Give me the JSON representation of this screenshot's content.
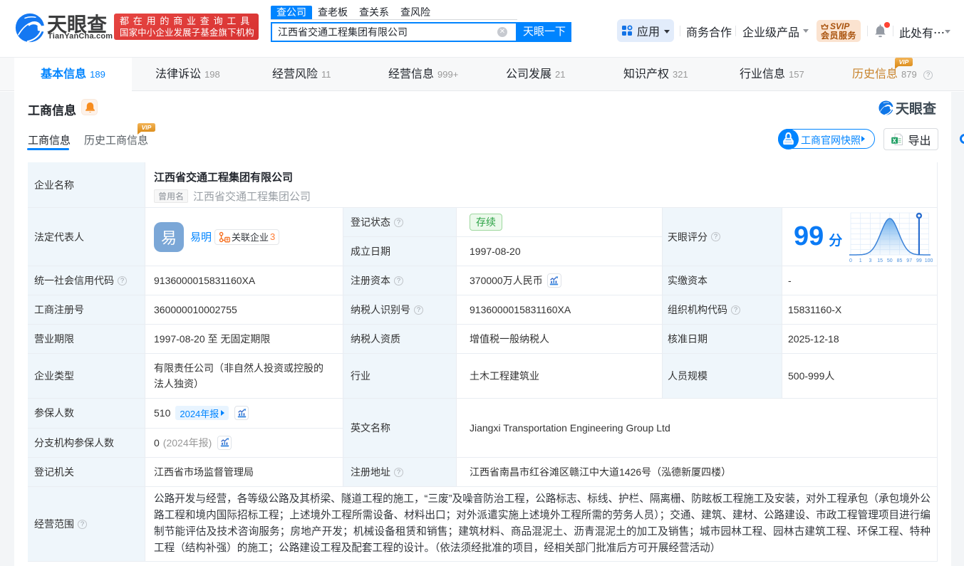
{
  "icons": {
    "help": "?",
    "clear": "✕",
    "ellipsis_caret": "",
    "score_ticks": [
      "0",
      "1",
      "3",
      "15",
      "50",
      "85",
      "97",
      "99",
      "100"
    ]
  },
  "brand": {
    "logo_title": "天眼查",
    "logo_domain": "TianYanCha.com",
    "slogan_line1": "都在用的商业查询工具",
    "slogan_line2": "国家中小企业发展子基金旗下机构",
    "watermark_title": "天眼查"
  },
  "header": {
    "search_tabs": [
      {
        "label": "查公司",
        "active": true
      },
      {
        "label": "查老板",
        "active": false
      },
      {
        "label": "查关系",
        "active": false
      },
      {
        "label": "查风险",
        "active": false
      }
    ],
    "search_value": "江西省交通工程集团有限公司",
    "search_button": "天眼一下",
    "menu_apps": "应用",
    "menu_biz": "商务合作",
    "menu_enterprise": "企业级产品",
    "svip_line1": "SVIP",
    "svip_line2": "会员服务",
    "user_entry": "此处有⋯"
  },
  "nav_tabs": [
    {
      "label": "基本信息",
      "count": "189"
    },
    {
      "label": "法律诉讼",
      "count": "198"
    },
    {
      "label": "经营风险",
      "count": "11"
    },
    {
      "label": "经营信息",
      "count": "999+"
    },
    {
      "label": "公司发展",
      "count": "21"
    },
    {
      "label": "知识产权",
      "count": "321"
    },
    {
      "label": "行业信息",
      "count": "157"
    },
    {
      "label": "历史信息",
      "count": "879",
      "vip": "VIP"
    }
  ],
  "section": {
    "title": "工商信息",
    "tab_current": "工商信息",
    "tab_history": "历史工商信息",
    "tab_history_vip": "VIP",
    "snapshot_button": "工商官网快照",
    "export_button": "导出"
  },
  "company": {
    "name_label": "企业名称",
    "name": "江西省交通工程集团有限公司",
    "former_tag": "曾用名",
    "former_name": "江西省交通工程集团公司",
    "legal_label": "法定代表人",
    "legal_avatar": "易",
    "legal_name": "易明",
    "related_label": "关联企业",
    "related_count": "3",
    "reg_status_label": "登记状态",
    "reg_status": "存续",
    "establish_label": "成立日期",
    "establish_date": "1997-08-20",
    "score_label": "天眼评分",
    "score": "99",
    "score_unit": "分",
    "uscc_label": "统一社会信用代码",
    "uscc": "9136000015831160XA",
    "reg_capital_label": "注册资本",
    "reg_capital": "370000万人民币",
    "paid_capital_label": "实缴资本",
    "paid_capital": "-",
    "reg_no_label": "工商注册号",
    "reg_no": "360000010002755",
    "tax_id_label": "纳税人识别号",
    "tax_id": "9136000015831160XA",
    "org_code_label": "组织机构代码",
    "org_code": "15831160-X",
    "term_label": "营业期限",
    "term": "1997-08-20 至 无固定期限",
    "tax_quality_label": "纳税人资质",
    "tax_quality": "增值税一般纳税人",
    "approve_date_label": "核准日期",
    "approve_date": "2025-12-18",
    "type_label": "企业类型",
    "type": "有限责任公司（非自然人投资或控股的法人独资）",
    "industry_label": "行业",
    "industry": "土木工程建筑业",
    "staff_label": "人员规模",
    "staff": "500-999人",
    "insured_label": "参保人数",
    "insured": "510",
    "insured_report": "2024年报",
    "branch_insured_label": "分支机构参保人数",
    "branch_insured": "0",
    "branch_insured_report": "(2024年报)",
    "en_name_label": "英文名称",
    "en_name": "Jiangxi Transportation Engineering Group Ltd",
    "authority_label": "登记机关",
    "authority": "江西省市场监督管理局",
    "address_label": "注册地址",
    "address": "江西省南昌市红谷滩区赣江中大道1426号（泓德新厦四楼）",
    "scope_label": "经营范围",
    "scope": "公路开发与经营，各等级公路及其桥梁、隧道工程的施工，“三废”及噪音防治工程，公路标志、标线、护栏、隔离栅、防眩板工程施工及安装，对外工程承包（承包境外公路工程和境内国际招标工程；上述境外工程所需设备、材料出口；对外派遣实施上述境外工程所需的劳务人员）；交通、建筑、建材、公路建设、市政工程管理项目进行编制节能评估及技术咨询服务；房地产开发；机械设备租赁和销售；建筑材料、商品混泥土、沥青混泥土的加工及销售；城市园林工程、园林古建筑工程、环保工程、特种工程（结构补强）的施工；公路建设工程及配套工程的设计。（依法须经批准的项目，经相关部门批准后方可开展经营活动）"
  },
  "score_chart": {
    "type": "area",
    "title": "天眼评分分布曲线",
    "x_ticks": [
      0,
      1,
      3,
      15,
      50,
      85,
      97,
      99,
      100
    ],
    "curve": "正态分布钟形曲线，峰值位于刻度50处",
    "marker_value": 99,
    "score": 99
  }
}
